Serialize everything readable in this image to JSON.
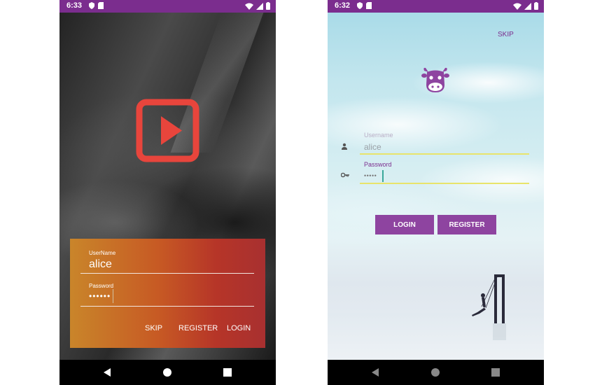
{
  "left_screen": {
    "status": {
      "time": "6:33"
    },
    "login": {
      "username_label": "UserName",
      "username_value": "alice",
      "password_label": "Password",
      "password_value": "••••••",
      "skip_label": "SKIP",
      "register_label": "REGISTER",
      "login_label": "LOGIN"
    },
    "logo_icon": "play-icon",
    "colors": {
      "logo": "#e8453c",
      "status_bar": "#7b2d8e",
      "card_start": "#c9852a",
      "card_end": "#a83030"
    }
  },
  "right_screen": {
    "status": {
      "time": "6:32"
    },
    "skip_label": "SKIP",
    "logo_icon": "cow-icon",
    "login": {
      "username_label": "Username",
      "username_value": "alice",
      "password_label": "Password",
      "password_value": "•••••",
      "login_label": "LOGIN",
      "register_label": "REGISTER"
    },
    "colors": {
      "accent": "#8e44a0",
      "status_bar": "#7b2d8e",
      "field_underline": "#e8e46a"
    }
  }
}
